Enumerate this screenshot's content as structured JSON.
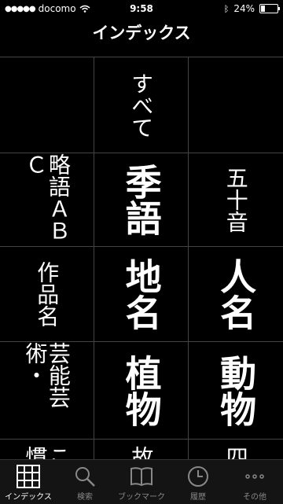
{
  "status": {
    "carrier": "docomo",
    "time": "9:58",
    "battery": "24%",
    "battery_level": 0.24
  },
  "nav": {
    "title": "インデックス"
  },
  "grid": [
    {
      "text": "すべて",
      "style": "small"
    },
    {
      "text": "略語ＡＢＣ",
      "style": "small"
    },
    {
      "text": "季語",
      "style": "big"
    },
    {
      "text": "五十音",
      "style": "small"
    },
    {
      "text": "作品名",
      "style": "small"
    },
    {
      "text": "地名",
      "style": "big"
    },
    {
      "text": "人名",
      "style": "big"
    },
    {
      "text": "芸能芸術・",
      "style": "small"
    },
    {
      "text": "植物",
      "style": "big"
    },
    {
      "text": "動物",
      "style": "big"
    },
    {
      "text": "こ慣",
      "style": "small"
    },
    {
      "text": "故",
      "style": "small"
    },
    {
      "text": "四",
      "style": "small"
    }
  ],
  "tabs": [
    {
      "label": "インデックス",
      "icon": "grid-icon",
      "active": true
    },
    {
      "label": "検索",
      "icon": "search-icon",
      "active": false
    },
    {
      "label": "ブックマーク",
      "icon": "book-icon",
      "active": false
    },
    {
      "label": "履歴",
      "icon": "clock-icon",
      "active": false
    },
    {
      "label": "その他",
      "icon": "more-icon",
      "active": false
    }
  ]
}
